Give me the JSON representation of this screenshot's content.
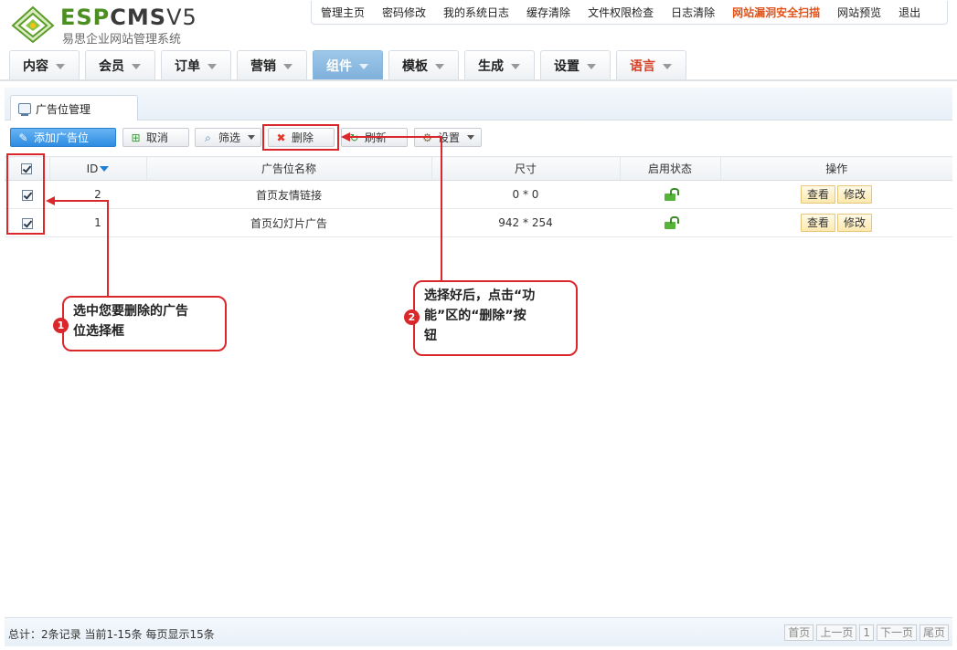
{
  "brand": {
    "logo_text_a": "ESP",
    "logo_text_b": "CMS",
    "logo_text_c": "V5",
    "subtitle": "易思企业网站管理系统"
  },
  "topmenu": [
    {
      "label": "管理主页",
      "alert": false
    },
    {
      "label": "密码修改",
      "alert": false
    },
    {
      "label": "我的系统日志",
      "alert": false
    },
    {
      "label": "缓存清除",
      "alert": false
    },
    {
      "label": "文件权限检查",
      "alert": false
    },
    {
      "label": "日志清除",
      "alert": false
    },
    {
      "label": "网站漏洞安全扫描",
      "alert": true
    },
    {
      "label": "网站预览",
      "alert": false
    },
    {
      "label": "退出",
      "alert": false
    }
  ],
  "mainnav": [
    {
      "label": "内容"
    },
    {
      "label": "会员"
    },
    {
      "label": "订单"
    },
    {
      "label": "营销"
    },
    {
      "label": "组件",
      "active": true
    },
    {
      "label": "模板"
    },
    {
      "label": "生成"
    },
    {
      "label": "设置"
    },
    {
      "label": "语言",
      "red": true
    }
  ],
  "panel": {
    "tab_label": "广告位管理"
  },
  "toolbar": {
    "add": "添加广告位",
    "cancel": "取消",
    "filter": "筛选",
    "delete": "删除",
    "refresh": "刷新",
    "settings": "设置"
  },
  "table": {
    "headers": {
      "id": "ID",
      "name": "广告位名称",
      "size": "尺寸",
      "status": "启用状态",
      "ops": "操作"
    },
    "rows": [
      {
        "id": "2",
        "name": "首页友情链接",
        "size": "0 * 0",
        "view": "查看",
        "edit": "修改"
      },
      {
        "id": "1",
        "name": "首页幻灯片广告",
        "size": "942 * 254",
        "view": "查看",
        "edit": "修改"
      }
    ]
  },
  "callouts": {
    "one": {
      "badge": "1",
      "line1": "选中您要删除的广告",
      "line2": "位选择框"
    },
    "two": {
      "badge": "2",
      "line1": "选择好后，点击“功",
      "line2": "能”区的“删除”按",
      "line3": "钮"
    }
  },
  "footer": {
    "info": "总计：2条记录 当前1-15条 每页显示15条",
    "pager": {
      "first": "首页",
      "prev": "上一页",
      "current": "1",
      "next": "下一页",
      "last": "尾页"
    }
  },
  "colors": {
    "highlight": "#d9272b",
    "active_tab": "#7fb1dc",
    "logo_green": "#4a8f1f"
  }
}
